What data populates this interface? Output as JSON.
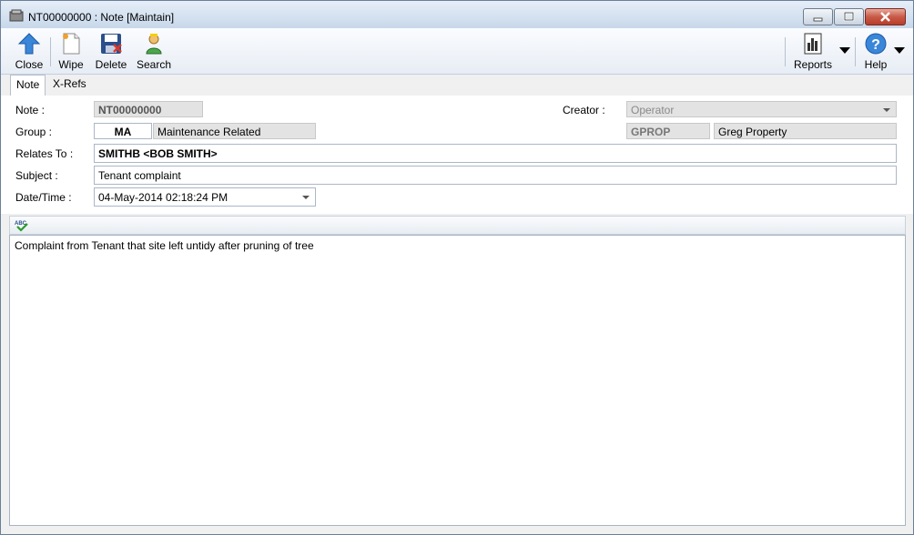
{
  "window": {
    "title": "NT00000000 : Note [Maintain]"
  },
  "toolbar": {
    "close": "Close",
    "wipe": "Wipe",
    "delete": "Delete",
    "search": "Search",
    "reports": "Reports",
    "help": "Help"
  },
  "tabs": [
    {
      "label": "Note"
    },
    {
      "label": "X-Refs"
    }
  ],
  "form": {
    "note_label": "Note :",
    "note_value": "NT00000000",
    "creator_label": "Creator :",
    "creator_value": "Operator",
    "group_label": "Group :",
    "group_code": "MA",
    "group_desc": "Maintenance Related",
    "creator_code": "GPROP",
    "creator_name": "Greg Property",
    "relates_label": "Relates To :",
    "relates_value": "SMITHB <BOB SMITH>",
    "subject_label": "Subject :",
    "subject_value": "Tenant complaint",
    "datetime_label": "Date/Time :",
    "datetime_value": "04-May-2014 02:18:24 PM"
  },
  "memo": {
    "text": "Complaint from Tenant that site left untidy after pruning of tree"
  },
  "icons": {
    "app": "note-app-icon",
    "close": "up-arrow-icon",
    "wipe": "blank-page-icon",
    "delete": "floppy-delete-icon",
    "search": "person-search-icon",
    "reports": "report-icon",
    "help": "help-icon",
    "spell": "spellcheck-icon"
  }
}
